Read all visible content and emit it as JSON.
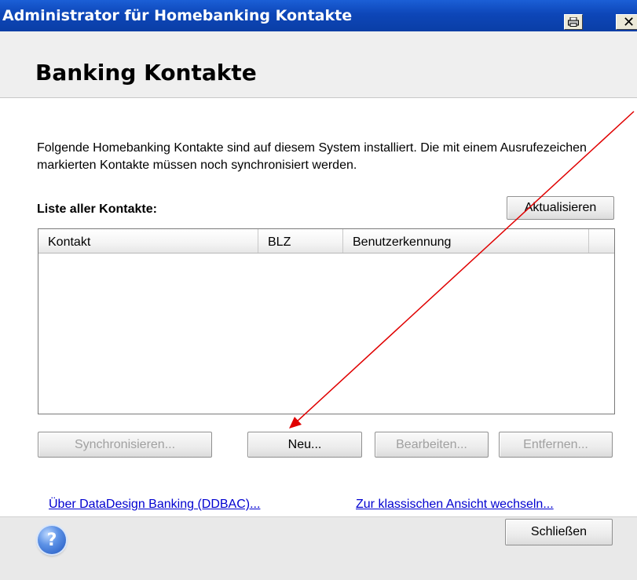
{
  "window": {
    "title": "Administrator für Homebanking Kontakte",
    "close_glyph": "✕"
  },
  "header": {
    "title": "Banking Kontakte"
  },
  "main": {
    "description": "Folgende Homebanking Kontakte sind auf diesem System installiert. Die mit einem Ausrufezeichen markierten Kontakte müssen noch synchronisiert werden.",
    "list_label": "Liste aller Kontakte:",
    "refresh_label": "Aktualisieren",
    "columns": [
      "Kontakt",
      "BLZ",
      "Benutzerkennung"
    ],
    "rows": []
  },
  "actions": {
    "synchronize_label": "Synchronisieren...",
    "new_label": "Neu...",
    "edit_label": "Bearbeiten...",
    "remove_label": "Entfernen..."
  },
  "links": {
    "about": "Über DataDesign Banking (DDBAC)...",
    "classic_view": "Zur klassischen Ansicht wechseln..."
  },
  "footer": {
    "help_glyph": "?",
    "close_label": "Schließen"
  },
  "colors": {
    "titlebar": "#0d46b8",
    "link": "#0000d0",
    "annotation_arrow": "#e00000"
  },
  "icons": [
    "print-icon",
    "close-icon",
    "help-icon"
  ]
}
